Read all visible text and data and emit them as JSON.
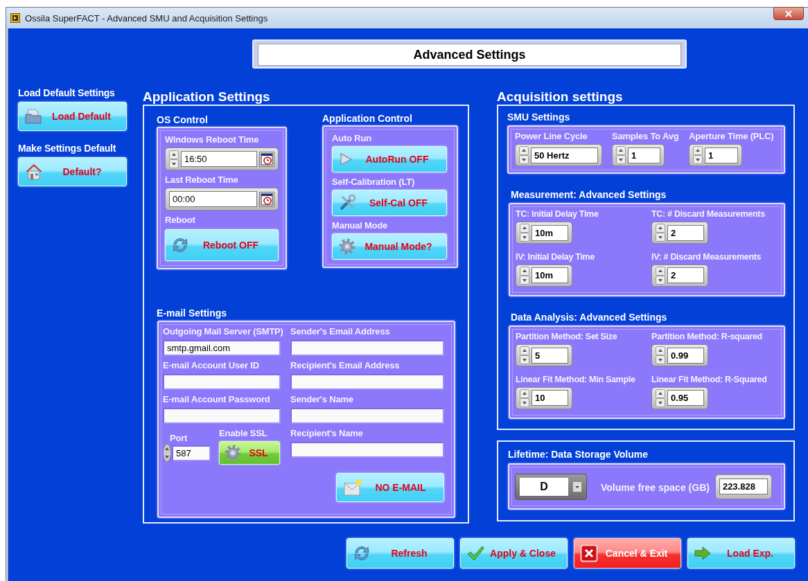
{
  "window": {
    "title": "Ossila SuperFACT - Advanced SMU and Acquisition Settings"
  },
  "header": {
    "title": "Advanced Settings"
  },
  "sidebar": [
    {
      "label": "Load Default Settings",
      "button": "Load Default"
    },
    {
      "label": "Make Settings Default",
      "button": "Default?"
    }
  ],
  "application_settings": {
    "title": "Application Settings",
    "os_control": {
      "title": "OS Control",
      "windows_reboot_time": {
        "label": "Windows Reboot Time",
        "value": "16:50"
      },
      "last_reboot_time": {
        "label": "Last Reboot Time",
        "value": "00:00"
      },
      "reboot": {
        "label": "Reboot",
        "button": "Reboot OFF",
        "on": false
      }
    },
    "application_control": {
      "title": "Application Control",
      "items": [
        {
          "label": "Auto Run",
          "button": "AutoRun OFF",
          "on": false
        },
        {
          "label": "Self-Calibration (LT)",
          "button": "Self-Cal OFF",
          "on": false
        },
        {
          "label": "Manual Mode",
          "button": "Manual Mode?",
          "on": false
        }
      ]
    },
    "email_settings": {
      "title": "E-mail Settings",
      "left_fields": [
        {
          "label": "Outgoing Mail Server (SMTP)",
          "value": "smtp.gmail.com"
        },
        {
          "label": "E-mail Account User ID"
        },
        {
          "label": "E-mail Account Password"
        }
      ],
      "right_fields": [
        {
          "label": "Sender's Email Address"
        },
        {
          "label": "Recipient's Email Address"
        },
        {
          "label": "Sender's Name"
        },
        {
          "label": "Recipient's Name"
        }
      ],
      "port": {
        "label": "Port",
        "value": "587"
      },
      "ssl": {
        "label": "Enable SSL",
        "button": "SSL",
        "on": true
      },
      "email_button": {
        "button": "NO E-MAIL",
        "on": false
      }
    }
  },
  "acquisition_settings": {
    "title": "Acquisition settings",
    "smu": {
      "title": "SMU Settings",
      "fields": [
        {
          "label": "Power Line Cycle",
          "value": "50 Hertz"
        },
        {
          "label": "Samples To Avg",
          "value": "1"
        },
        {
          "label": "Aperture Time (PLC)",
          "value": "1"
        }
      ]
    },
    "measurement": {
      "title": "Measurement: Advanced Settings",
      "fields": [
        {
          "label": "TC: Initial Delay Time",
          "value": "10m"
        },
        {
          "label": "TC: # Discard Measurements",
          "value": "2"
        },
        {
          "label": "IV: Initial Delay Time",
          "value": "10m"
        },
        {
          "label": "IV: # Discard Measurements",
          "value": "2"
        }
      ]
    },
    "data_analysis": {
      "title": "Data Analysis: Advanced Settings",
      "fields": [
        {
          "label": "Partition Method: Set Size",
          "value": "5"
        },
        {
          "label": "Partition Method: R-squared",
          "value": "0.99"
        },
        {
          "label": "Linear Fit Method: Min Sample",
          "value": "10"
        },
        {
          "label": "Linear Fit Method: R-Squared",
          "value": "0.95"
        }
      ]
    }
  },
  "lifetime": {
    "title": "Lifetime: Data Storage Volume",
    "volume": "D",
    "free_space_label": "Volume free space (GB)",
    "free_space": "223.828"
  },
  "footer": [
    {
      "label": "Refresh",
      "kind": "normal"
    },
    {
      "label": "Apply & Close",
      "kind": "normal"
    },
    {
      "label": "Cancel & Exit",
      "kind": "cancel"
    },
    {
      "label": "Load Exp.",
      "kind": "normal"
    }
  ]
}
